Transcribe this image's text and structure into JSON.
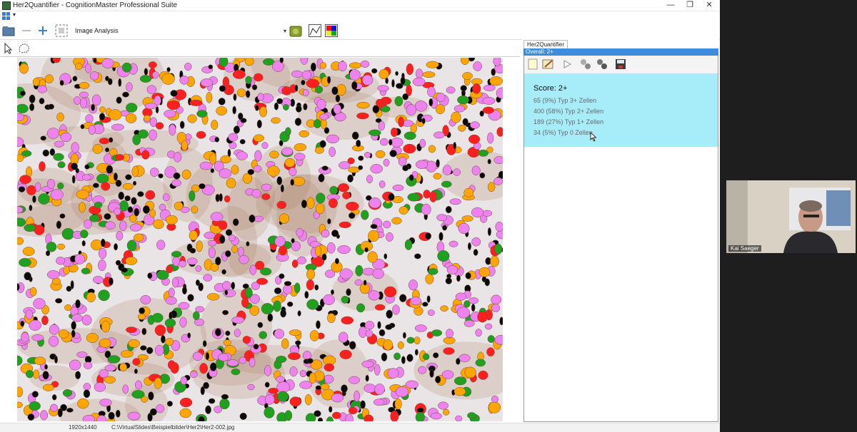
{
  "window": {
    "title": "Her2Quantifier - CognitionMaster Professional Suite"
  },
  "window_buttons": {
    "minimize": "—",
    "restore": "❐",
    "close": "✕"
  },
  "toolbar": {
    "analysis_select": "Image Analysis"
  },
  "panel": {
    "tab": "Her2Quantifier",
    "header": "Overall: 2+",
    "score": "Score: 2+",
    "results": [
      "65 (9%) Typ 3+ Zellen",
      "400 (58%) Typ 2+ Zellen",
      "189 (27%) Typ 1+ Zellen",
      "34 (5%) Typ 0 Zellen"
    ]
  },
  "statusbar": {
    "dimensions": "1920x1440",
    "path": "C:\\VirtualSlides\\Beispielbilder\\Her2\\Her2-002.jpg"
  },
  "video": {
    "participant": "Kai Saeger"
  },
  "colors": {
    "type3": "#ff1f1f",
    "type2": "#ee82ee",
    "type1": "#ffa500",
    "type0": "#1fa01f",
    "negative": "#0a0a0a",
    "result_bg": "#a6ecf9",
    "header_bg": "#3c8ce0"
  },
  "icons": [
    "app-icon",
    "grid-icon",
    "open-folder-icon",
    "minus-icon",
    "plus-icon",
    "fit-window-icon",
    "module-icon",
    "graph-icon",
    "color-channels-icon",
    "pointer-icon",
    "lasso-icon",
    "new-doc-icon",
    "edit-icon",
    "play-icon",
    "cells-icon",
    "cells-dark-icon",
    "save-icon"
  ]
}
